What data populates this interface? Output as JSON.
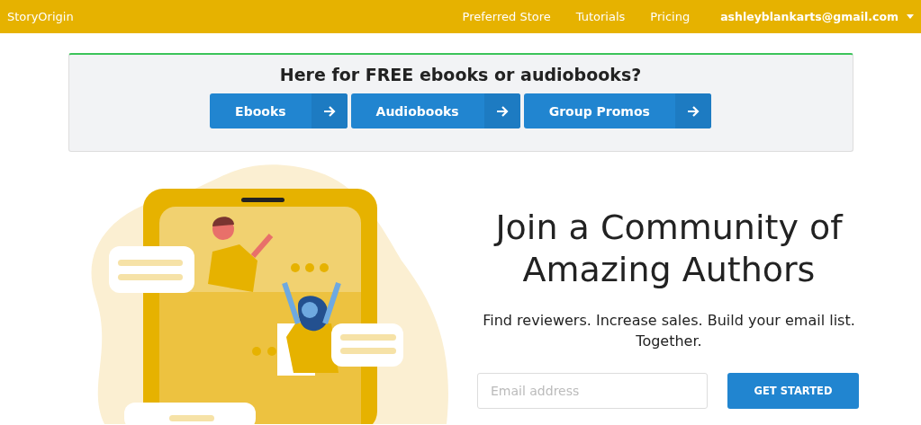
{
  "navbar": {
    "brand": "StoryOrigin",
    "links": [
      "Preferred Store",
      "Tutorials",
      "Pricing"
    ],
    "account": "ashleyblankarts@gmail.com"
  },
  "banner": {
    "title": "Here for FREE ebooks or audiobooks?",
    "buttons": [
      "Ebooks",
      "Audiobooks",
      "Group Promos"
    ]
  },
  "hero": {
    "heading": "Join a Community of Amazing Authors",
    "subtitle": "Find reviewers. Increase sales. Build your email list. Together.",
    "email_field": {
      "placeholder": "Email address"
    },
    "cta": "GET STARTED"
  }
}
